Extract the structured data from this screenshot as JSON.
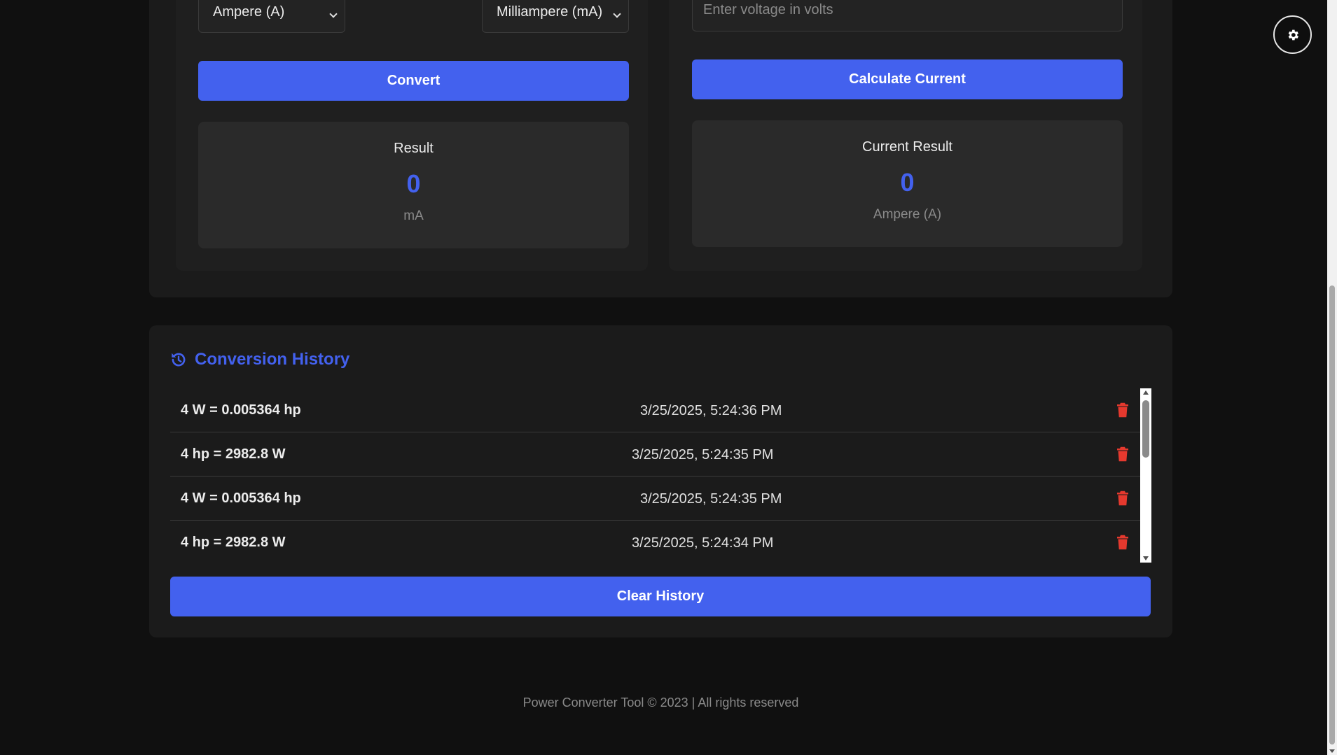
{
  "converter": {
    "from_unit": "Ampere (A)",
    "to_unit": "Milliampere (mA)",
    "convert_label": "Convert",
    "result": {
      "title": "Result",
      "value": "0",
      "unit": "mA"
    }
  },
  "current_calc": {
    "voltage_placeholder": "Enter voltage in volts",
    "calculate_label": "Calculate Current",
    "result": {
      "title": "Current Result",
      "value": "0",
      "unit": "Ampere (A)"
    }
  },
  "history": {
    "title": "Conversion History",
    "entries": [
      {
        "expr": "4 W = 0.005364 hp",
        "time": "3/25/2025, 5:24:36 PM"
      },
      {
        "expr": "4 hp = 2982.8 W",
        "time": "3/25/2025, 5:24:35 PM"
      },
      {
        "expr": "4 W = 0.005364 hp",
        "time": "3/25/2025, 5:24:35 PM"
      },
      {
        "expr": "4 hp = 2982.8 W",
        "time": "3/25/2025, 5:24:34 PM"
      }
    ],
    "clear_label": "Clear History"
  },
  "footer": {
    "text": "Power Converter Tool © 2023 | All rights reserved"
  },
  "colors": {
    "accent": "#4361ee",
    "danger": "#e5392e",
    "background": "#101010",
    "card": "#1b1b1b"
  },
  "icons": {
    "settings": "gear-icon",
    "history": "history-icon",
    "delete": "trash-icon"
  }
}
